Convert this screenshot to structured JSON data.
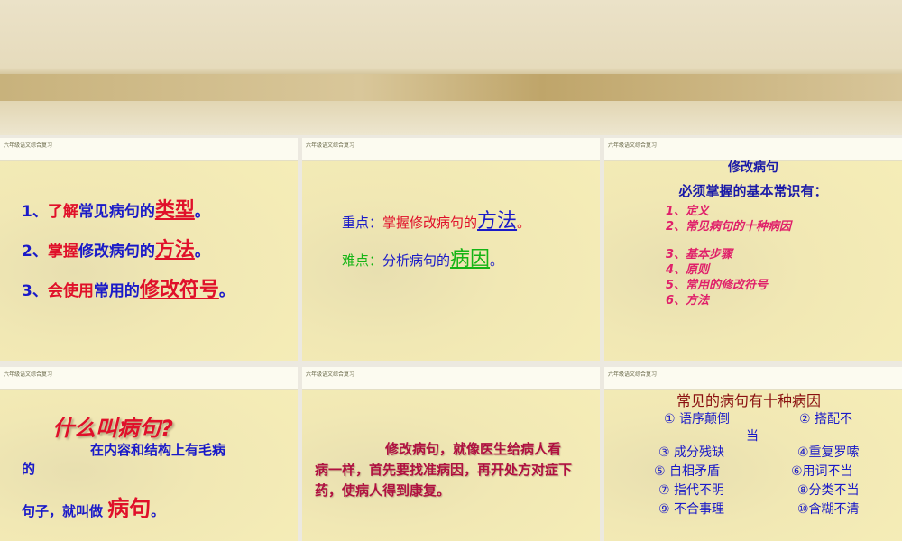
{
  "header_label": "六年级语文综合复习",
  "slide1": {
    "items": [
      {
        "num": "1、",
        "a": "了解",
        "b": "常见病句的",
        "c": "类型",
        "d": "。"
      },
      {
        "num": "2、",
        "a": "掌握",
        "b": "修改病句的",
        "c": "方法",
        "d": "。"
      },
      {
        "num": "3、",
        "a": "会使用",
        "b": "常用的",
        "c": "修改符号",
        "d": "。"
      }
    ]
  },
  "slide2": {
    "key_label": "重点：",
    "key_text": "掌握修改病句的",
    "key_em": "方法",
    "key_end": "。",
    "diff_label": "难点：",
    "diff_text": "分析病句的",
    "diff_em": "病因",
    "diff_end": "。"
  },
  "slide3": {
    "title": "修改病句",
    "subtitle": "必须掌握的基本常识有：",
    "items": [
      "1、定义",
      "2、常见病句的十种病因",
      "3、基本步骤",
      "4、原则",
      "5、常用的修改符号",
      "6、方法"
    ]
  },
  "slide4": {
    "title": "什么叫病句?",
    "line1": "在内容和结构上有毛病",
    "line2": "的",
    "line3": "句子，就叫做",
    "em": "病句",
    "end": "。"
  },
  "slide5": {
    "text": "修改病句，就像医生给病人看病一样，首先要找准病因，再开处方对症下药，使病人得到康复。"
  },
  "slide6": {
    "title": "常见的病句有十种病因",
    "items": [
      "① 语序颠倒",
      "② 搭配不",
      "当",
      "③ 成分残缺",
      "④重复罗嗦",
      "⑤ 自相矛盾",
      "⑥用词不当",
      "⑦ 指代不明",
      "⑧分类不当",
      "⑨ 不合事理",
      "⑩含糊不清"
    ]
  }
}
